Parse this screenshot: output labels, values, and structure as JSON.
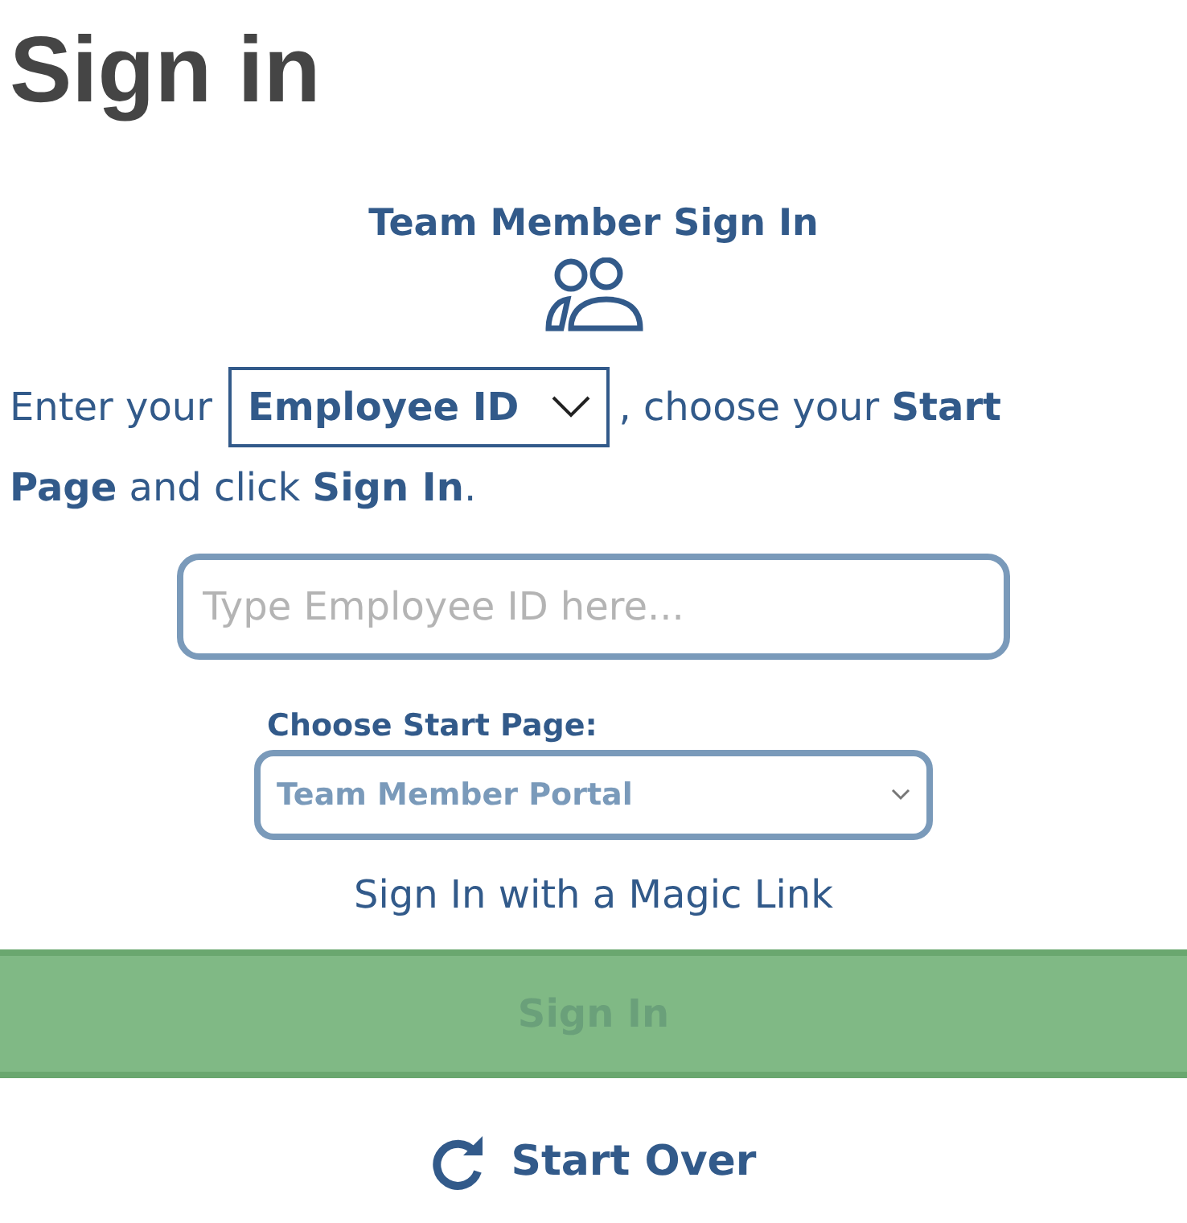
{
  "page_title": "Sign in",
  "panel": {
    "heading": "Team Member Sign In",
    "instruction": {
      "before": "Enter your",
      "id_type": {
        "value": "Employee ID"
      },
      "after": ", choose your **Start**",
      "continued": "**Page** and click **Sign In**."
    },
    "id_field": {
      "placeholder": "Type Employee ID here..."
    },
    "start_page": {
      "label": "Choose Start Page:",
      "value": "Team Member Portal"
    },
    "magic_link": "Sign In with a Magic Link",
    "sign_in_button": {
      "label": "Sign In",
      "disabled": true
    },
    "start_over": "Start Over"
  }
}
